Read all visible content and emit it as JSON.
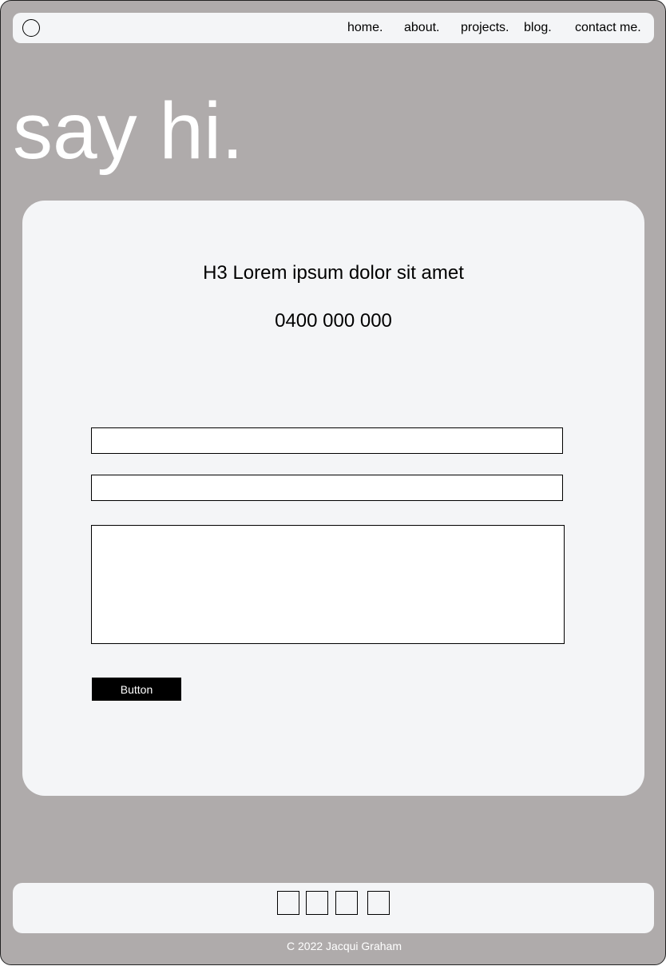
{
  "nav": {
    "logo_icon": "circle-logo-icon",
    "links": [
      {
        "label": "home."
      },
      {
        "label": "about."
      },
      {
        "label": "projects."
      },
      {
        "label": "blog."
      },
      {
        "label": "contact me."
      }
    ]
  },
  "hero": {
    "title": "say hi."
  },
  "contact_card": {
    "heading": "H3 Lorem ipsum dolor sit amet",
    "phone": "0400 000 000",
    "fields": {
      "field_1_value": "",
      "field_2_value": "",
      "message_value": ""
    },
    "button_label": "Button"
  },
  "footer": {
    "social_icons": [
      "social-icon-1",
      "social-icon-2",
      "social-icon-3",
      "social-icon-4"
    ],
    "copyright": "C 2022 Jacqui Graham"
  },
  "colors": {
    "page_background": "#afabab",
    "panel_background": "#f4f5f7",
    "button_background": "#000000",
    "hero_text": "#ffffff"
  }
}
